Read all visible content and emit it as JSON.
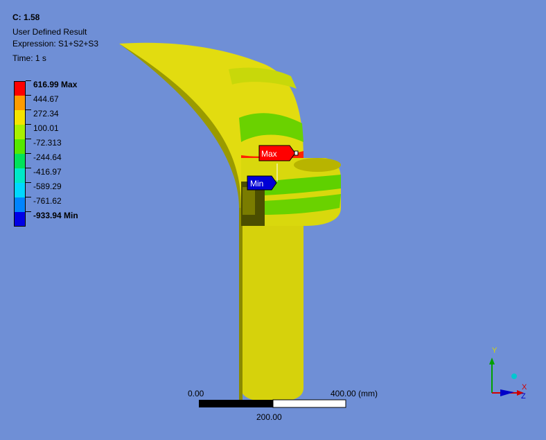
{
  "header": {
    "title": "C: 1.58",
    "result_type": "User Defined Result",
    "expression": "Expression: S1+S2+S3",
    "time": "Time: 1 s"
  },
  "legend": {
    "entries": [
      {
        "label": "616.99 Max",
        "bold": true,
        "color": "#ff0000"
      },
      {
        "label": "444.67",
        "bold": false,
        "color": "#ff9c00"
      },
      {
        "label": "272.34",
        "bold": false,
        "color": "#f6e400"
      },
      {
        "label": "100.01",
        "bold": false,
        "color": "#a8f000"
      },
      {
        "label": "-72.313",
        "bold": false,
        "color": "#55e800"
      },
      {
        "label": "-244.64",
        "bold": false,
        "color": "#00e25a"
      },
      {
        "label": "-416.97",
        "bold": false,
        "color": "#00e8c8"
      },
      {
        "label": "-589.29",
        "bold": false,
        "color": "#00d8ff"
      },
      {
        "label": "-761.62",
        "bold": false,
        "color": "#0084ff"
      },
      {
        "label": "-933.94 Min",
        "bold": true,
        "color": "#0000e6"
      }
    ]
  },
  "probes": {
    "max_label": "Max",
    "min_label": "Min",
    "max_color": "#ff0000",
    "min_color": "#0000d6"
  },
  "scale_bar": {
    "left_label": "0.00",
    "right_label": "400.00 (mm)",
    "mid_label": "200.00"
  },
  "triad": {
    "x_label": "X",
    "y_label": "Y",
    "z_label": "Z"
  },
  "colors": {
    "background": "#6f8fd6",
    "body": "#d8d80a",
    "band_green": "#6ad200",
    "band_red": "#ff2200"
  }
}
